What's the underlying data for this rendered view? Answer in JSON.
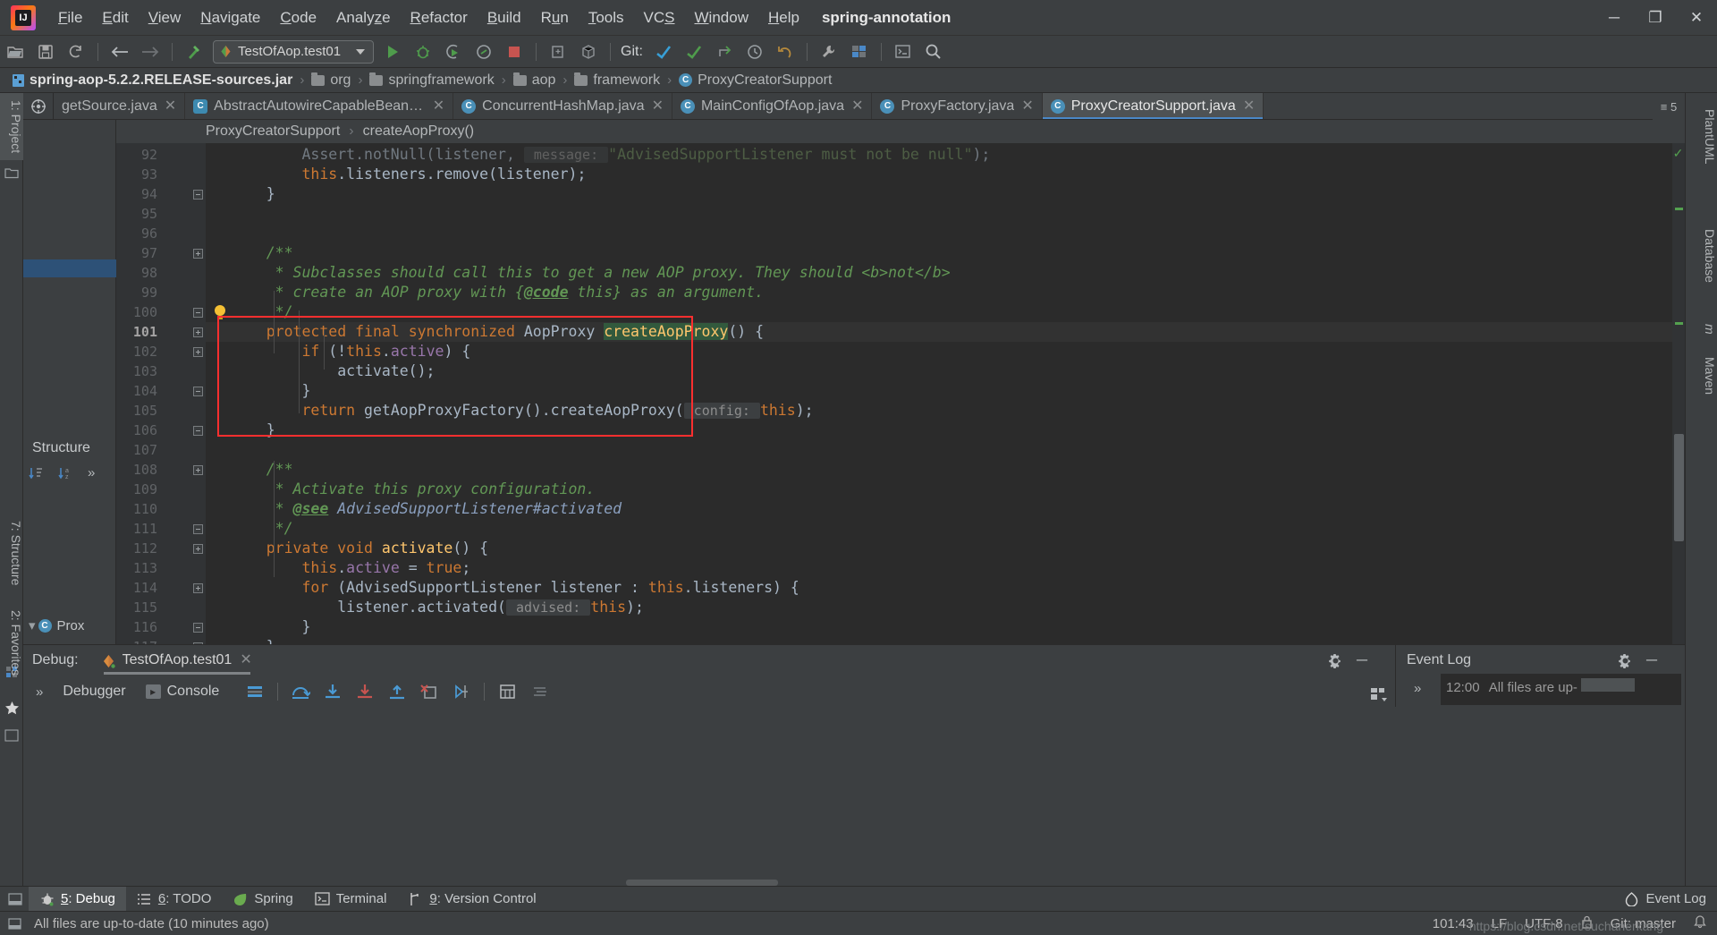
{
  "window": {
    "project_name": "spring-annotation",
    "minimize_label": "─",
    "maximize_label": "❐",
    "close_label": "✕"
  },
  "menubar": {
    "items": [
      {
        "label": "File",
        "mnemonic": "F"
      },
      {
        "label": "Edit",
        "mnemonic": "E"
      },
      {
        "label": "View",
        "mnemonic": "V"
      },
      {
        "label": "Navigate",
        "mnemonic": "N"
      },
      {
        "label": "Code",
        "mnemonic": "C"
      },
      {
        "label": "Analyze",
        "mnemonic": "z"
      },
      {
        "label": "Refactor",
        "mnemonic": "R"
      },
      {
        "label": "Build",
        "mnemonic": "B"
      },
      {
        "label": "Run",
        "mnemonic": "u"
      },
      {
        "label": "Tools",
        "mnemonic": "T"
      },
      {
        "label": "VCS",
        "mnemonic": "S"
      },
      {
        "label": "Window",
        "mnemonic": "W"
      },
      {
        "label": "Help",
        "mnemonic": "H"
      }
    ]
  },
  "toolbar": {
    "run_config": "TestOfAop.test01",
    "git_label": "Git:",
    "icons": [
      "open-project-icon",
      "save-all-icon",
      "sync-refresh-icon",
      "navigate-back-icon",
      "navigate-forward-icon",
      "build-hammer-icon",
      "run-icon",
      "debug-icon",
      "run-coverage-icon",
      "profiler-icon",
      "stop-icon",
      "attach-debugger-icon",
      "package-icon",
      "git-update-icon",
      "git-commit-icon",
      "git-push-icon",
      "git-history-icon",
      "git-revert-icon",
      "settings-wrench-icon",
      "structure-icon",
      "terminal-icon",
      "search-everywhere-icon"
    ]
  },
  "navbar": {
    "crumbs": [
      {
        "label": "spring-aop-5.2.2.RELEASE-sources.jar",
        "icon": "jar-icon"
      },
      {
        "label": "org",
        "icon": "folder-icon"
      },
      {
        "label": "springframework",
        "icon": "folder-icon"
      },
      {
        "label": "aop",
        "icon": "folder-icon"
      },
      {
        "label": "framework",
        "icon": "folder-icon"
      },
      {
        "label": "ProxyCreatorSupport",
        "icon": "class-icon"
      }
    ],
    "separator": "›"
  },
  "editor_tabs": {
    "more_label": "≡ 5",
    "items": [
      {
        "label": "getSource.java",
        "icon": "class-icon",
        "active": false,
        "close": "✕"
      },
      {
        "label": "AbstractAutowireCapableBeanFactory.java",
        "icon": "class-icon",
        "active": false,
        "close": "✕"
      },
      {
        "label": "ConcurrentHashMap.java",
        "icon": "class-icon",
        "active": false,
        "close": "✕"
      },
      {
        "label": "MainConfigOfAop.java",
        "icon": "class-icon",
        "active": false,
        "close": "✕"
      },
      {
        "label": "ProxyFactory.java",
        "icon": "class-icon",
        "active": false,
        "close": "✕"
      },
      {
        "label": "ProxyCreatorSupport.java",
        "icon": "class-icon",
        "active": true,
        "close": "✕"
      }
    ]
  },
  "editor_breadcrumbs": {
    "separator": "›",
    "items": [
      "ProxyCreatorSupport",
      "createAopProxy()"
    ]
  },
  "left_strip": {
    "project_tab": "1: Project",
    "structure_tab": "7: Structure",
    "favorites_tab": "2: Favorites"
  },
  "right_strip": {
    "tabs": [
      "PlantUML",
      "Database",
      "m",
      "Maven"
    ]
  },
  "project_panel": {
    "tab_label": "P...",
    "rows": [
      "Prox"
    ]
  },
  "structure_panel": {
    "title": "Structure"
  },
  "code": {
    "caret_position": "101:43",
    "lines": [
      {
        "n": 92,
        "html": "        Assert.notNull(listener, <span class=\"hint\"> message: </span><span class=\"str\">\"AdvisedSupportListener must not be null\"</span>);",
        "fold": null,
        "faded": true
      },
      {
        "n": 93,
        "html": "        <span class=\"kw\">this</span>.listeners.remove(listener);",
        "fold": null
      },
      {
        "n": 94,
        "html": "    }",
        "fold": "close"
      },
      {
        "n": 95,
        "html": "",
        "fold": null
      },
      {
        "n": 96,
        "html": "",
        "fold": null
      },
      {
        "n": 97,
        "html": "    <span class=\"cmt\">/**</span>",
        "fold": "open"
      },
      {
        "n": 98,
        "html": "     <span class=\"cmt\">* Subclasses should call this to get a new AOP proxy. They should </span><span class=\"cmt-html\">&lt;b&gt;</span><span class=\"cmt\">not</span><span class=\"cmt-html\">&lt;/b&gt;</span>",
        "fold": null
      },
      {
        "n": 99,
        "html": "     <span class=\"cmt\">* create an AOP proxy with {</span><span class=\"cmt-tag\">@code</span><span class=\"cmt\"> this} as an argument.</span>",
        "fold": null
      },
      {
        "n": 100,
        "html": "     <span class=\"cmt\">*/</span>",
        "fold": "close",
        "bulb": true
      },
      {
        "n": 101,
        "html": "    <span class=\"kw\">protected final synchronized </span><span class=\"typ\">AopProxy </span><span class=\"mth mth-hl\">createAopProxy</span>() {",
        "fold": "open",
        "current": true
      },
      {
        "n": 102,
        "html": "        <span class=\"kw\">if </span>(!<span class=\"kw\">this</span>.<span class=\"fld\">active</span>) {",
        "fold": "open"
      },
      {
        "n": 103,
        "html": "            activate();",
        "fold": null
      },
      {
        "n": 104,
        "html": "        }",
        "fold": "close"
      },
      {
        "n": 105,
        "html": "        <span class=\"kw\">return </span>getAopProxyFactory().createAopProxy(<span class=\"hint\"> config: </span><span class=\"kw\">this</span>);",
        "fold": null
      },
      {
        "n": 106,
        "html": "    }",
        "fold": "close"
      },
      {
        "n": 107,
        "html": "",
        "fold": null
      },
      {
        "n": 108,
        "html": "    <span class=\"cmt\">/**</span>",
        "fold": "open"
      },
      {
        "n": 109,
        "html": "     <span class=\"cmt\">* Activate this proxy configuration.</span>",
        "fold": null
      },
      {
        "n": 110,
        "html": "     <span class=\"cmt\">* </span><span class=\"cmt-tag\">@see</span><span class=\"cmt-tag2\"> AdvisedSupportListener#activated</span>",
        "fold": null
      },
      {
        "n": 111,
        "html": "     <span class=\"cmt\">*/</span>",
        "fold": "close"
      },
      {
        "n": 112,
        "html": "    <span class=\"kw\">private void </span><span class=\"mth\">activate</span>() {",
        "fold": "open"
      },
      {
        "n": 113,
        "html": "        <span class=\"kw\">this</span>.<span class=\"fld\">active </span>= <span class=\"kw\">true</span>;",
        "fold": null
      },
      {
        "n": 114,
        "html": "        <span class=\"kw\">for </span>(AdvisedSupportListener listener : <span class=\"kw\">this</span>.listeners) {",
        "fold": "open"
      },
      {
        "n": 115,
        "html": "            listener.activated(<span class=\"hint\"> advised: </span><span class=\"kw\">this</span>);",
        "fold": null
      },
      {
        "n": 116,
        "html": "        }",
        "fold": "close"
      },
      {
        "n": 117,
        "html": "    }",
        "fold": "close"
      }
    ]
  },
  "debug_panel": {
    "label": "Debug:",
    "config_name": "TestOfAop.test01",
    "close": "✕",
    "tabs": [
      {
        "label": "Debugger",
        "icon": "debugger-icon"
      },
      {
        "label": "Console",
        "icon": "console-icon"
      }
    ],
    "toolbar_icons": [
      "layout-icon",
      "step-over-icon",
      "step-into-icon",
      "force-step-into-icon",
      "step-out-icon",
      "drop-frame-icon",
      "run-to-cursor-icon",
      "evaluate-expression-icon",
      "mute-breakpoints-icon"
    ],
    "settings_icon": "gear-icon",
    "minimize_icon": "─",
    "expand_icon": "»"
  },
  "event_log": {
    "title": "Event Log",
    "settings_icon": "gear-icon",
    "minimize_icon": "─",
    "expand_icon": "»",
    "entry_time": "12:00",
    "entry_text": "All files are up-"
  },
  "bottom_bar": {
    "windows": [
      {
        "label": "5: Debug",
        "mnemonic": "5",
        "icon": "debug-bug-icon",
        "selected": true
      },
      {
        "label": "6: TODO",
        "mnemonic": "6",
        "icon": "todo-list-icon",
        "selected": false
      },
      {
        "label": "Spring",
        "mnemonic": "",
        "icon": "spring-leaf-icon",
        "selected": false
      },
      {
        "label": "Terminal",
        "mnemonic": "",
        "icon": "terminal-icon",
        "selected": false
      },
      {
        "label": "9: Version Control",
        "mnemonic": "9",
        "icon": "branch-icon",
        "selected": false
      }
    ],
    "right_window": {
      "label": "Event Log",
      "icon": "event-log-icon"
    }
  },
  "statusbar": {
    "message": "All files are up-to-date (10 minutes ago)",
    "caret": "101:43",
    "line_sep": "LF",
    "encoding": "UTF-8",
    "branch": "Git: master",
    "lock_icon": "lock-icon",
    "watermark": "https://blog.csdn.net/suchanerkang"
  },
  "colors": {
    "accent_blue": "#4a88c7",
    "panel_bg": "#3c3f41",
    "editor_bg": "#2b2b2b",
    "gutter_bg": "#313335",
    "highlight_box": "#ff2f2f",
    "keyword": "#cc7832",
    "comment": "#629755",
    "method": "#ffc66d",
    "field": "#9876aa",
    "string": "#6a8759",
    "selection": "#2d5177",
    "green_ok": "#54a14f"
  }
}
